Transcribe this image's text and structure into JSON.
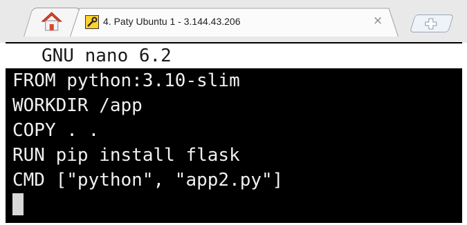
{
  "tabs": {
    "home_icon": "home-icon",
    "active_tab": {
      "icon": "tool-icon",
      "title": "4. Paty Ubuntu 1 - 3.144.43.206",
      "close_glyph": "×"
    },
    "new_tab_icon": "plus-icon"
  },
  "terminal": {
    "header": "GNU nano 6.2",
    "lines": [
      "FROM python:3.10-slim",
      "WORKDIR /app",
      "COPY . .",
      "RUN pip install flask",
      "CMD [\"python\", \"app2.py\"]"
    ]
  },
  "colors": {
    "terminal_bg": "#000000",
    "terminal_fg": "#f0f0f0",
    "header_bg": "#ffffff",
    "home_roof": "#e0442a"
  }
}
